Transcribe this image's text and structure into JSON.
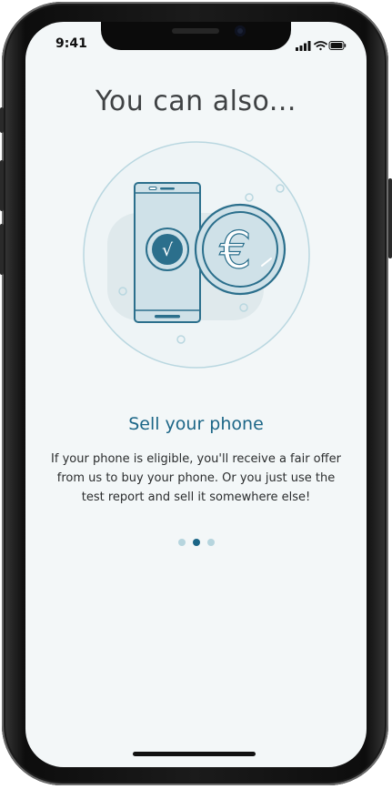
{
  "status_bar": {
    "time": "9:41"
  },
  "onboarding": {
    "heading": "You can also...",
    "card": {
      "title": "Sell your phone",
      "body": "If your phone is eligible, you'll receive a fair offer from us to buy your phone. Or you just use the test report and sell it somewhere else!"
    },
    "pagination": {
      "total": 3,
      "active_index": 1
    },
    "illustration": {
      "checkmark_glyph": "√",
      "currency_symbol": "€"
    }
  },
  "colors": {
    "accent": "#1c6687",
    "screen_bg": "#f3f7f8",
    "dot_inactive": "#b6d5de",
    "illustration_fill": "#cfe1e8",
    "illustration_stroke": "#2b6f8c"
  }
}
